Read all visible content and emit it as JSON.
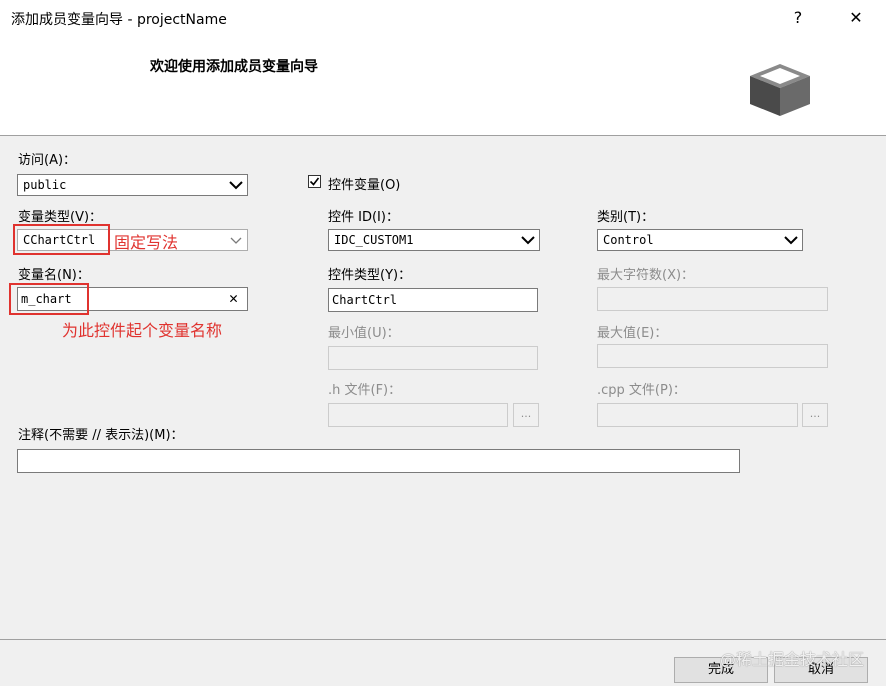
{
  "window": {
    "title": "添加成员变量向导 - projectName",
    "help_label": "?",
    "close_label": "✕"
  },
  "header": {
    "heading": "欢迎使用添加成员变量向导",
    "logo_icon": "box-icon"
  },
  "form": {
    "access_label": "访问(A)：",
    "access_value": "public",
    "control_var_label": "控件变量(O)",
    "control_var_checked": true,
    "var_type_label": "变量类型(V)：",
    "var_type_value": "CChartCtrl",
    "control_id_label": "控件 ID(I)：",
    "control_id_value": "IDC_CUSTOM1",
    "category_label": "类别(T)：",
    "category_value": "Control",
    "var_name_label": "变量名(N)：",
    "var_name_value": "m_chart",
    "control_type_label": "控件类型(Y)：",
    "control_type_value": "ChartCtrl",
    "max_chars_label": "最大字符数(X)：",
    "min_value_label": "最小值(U)：",
    "max_value_label": "最大值(E)：",
    "h_file_label": ".h 文件(F)：",
    "cpp_file_label": ".cpp 文件(P)：",
    "browse_label": "...",
    "comment_label": "注释(不需要 // 表示法)(M)：",
    "comment_value": ""
  },
  "annotations": {
    "fixed_syntax": "固定写法",
    "name_hint": "为此控件起个变量名称"
  },
  "buttons": {
    "finish": "完成",
    "cancel": "取消"
  },
  "watermark": "@稀土掘金技术社区",
  "colors": {
    "annotation_red": "#e0332f",
    "header_bg": "#ffffff",
    "body_bg": "#f0f0f0"
  }
}
